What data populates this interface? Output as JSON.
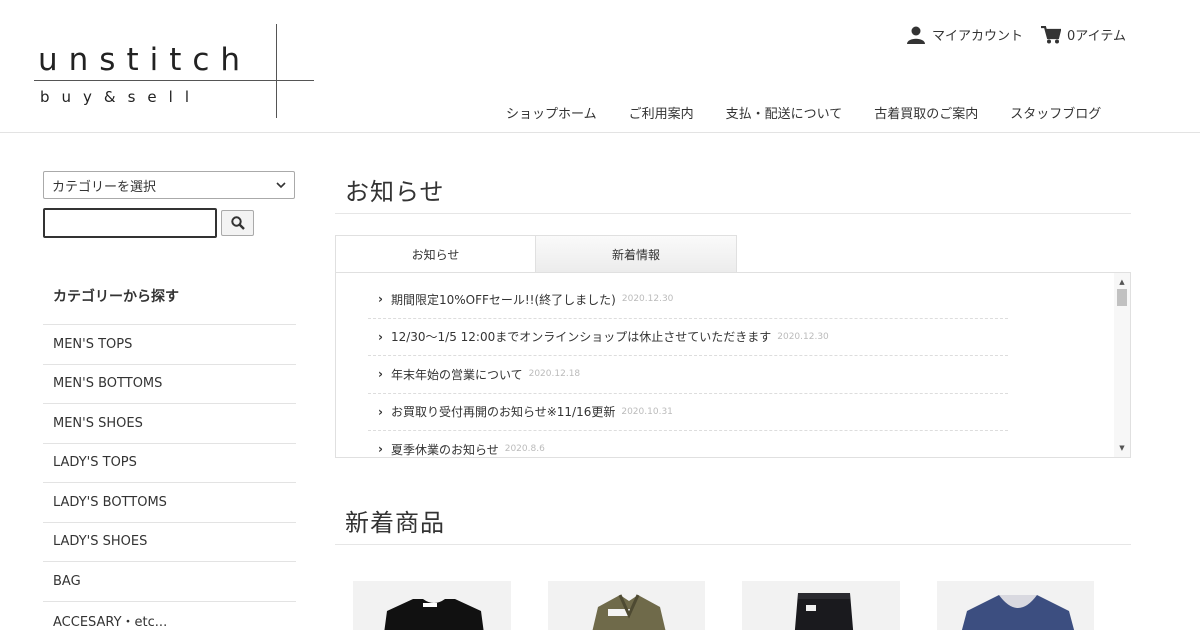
{
  "logo": {
    "main": "unstitch",
    "sub": "buy&sell"
  },
  "account": {
    "my_account": "マイアカウント",
    "cart": "0アイテム"
  },
  "nav": [
    "ショップホーム",
    "ご利用案内",
    "支払・配送について",
    "古着買取のご案内",
    "スタッフブログ"
  ],
  "sidebar": {
    "category_select": "カテゴリーを選択",
    "search_value": "",
    "heading": "カテゴリーから探す",
    "categories": [
      "MEN'S TOPS",
      "MEN'S BOTTOMS",
      "MEN'S SHOES",
      "LADY'S TOPS",
      "LADY'S BOTTOMS",
      "LADY'S SHOES",
      "BAG",
      "ACCESARY・etc..."
    ]
  },
  "main": {
    "news_title": "お知らせ",
    "tabs": [
      "お知らせ",
      "新着情報"
    ],
    "news": [
      {
        "text": "期間限定10%OFFセール!!(終了しました)",
        "date": "2020.12.30"
      },
      {
        "text": "12/30～1/5 12:00までオンラインショップは休止させていただきます",
        "date": "2020.12.30"
      },
      {
        "text": "年末年始の営業について",
        "date": "2020.12.18"
      },
      {
        "text": "お買取り受付再開のお知らせ※11/16更新",
        "date": "2020.10.31"
      },
      {
        "text": "夏季休業のお知らせ",
        "date": "2020.8.6"
      }
    ],
    "new_items_title": "新着商品"
  },
  "colors": {
    "text": "#333333",
    "border": "#e3e3e3",
    "date": "#bbbbbb"
  }
}
